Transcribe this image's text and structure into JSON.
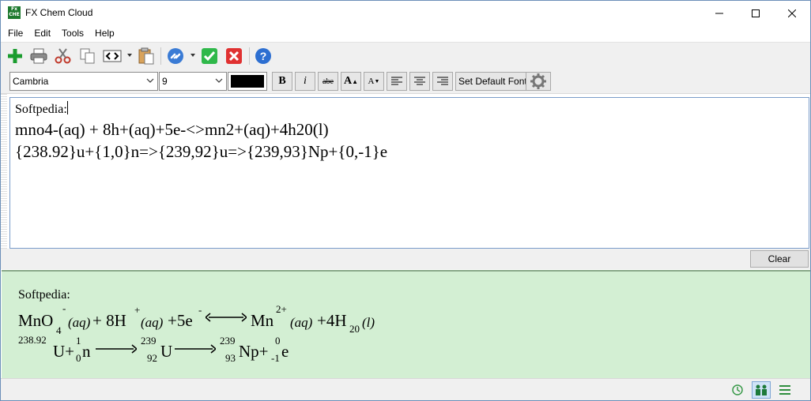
{
  "window": {
    "title": "FX Chem Cloud"
  },
  "menu": {
    "items": [
      "File",
      "Edit",
      "Tools",
      "Help"
    ]
  },
  "toolbar": {
    "icons": [
      "add-icon",
      "print-icon",
      "cut-icon",
      "copy-icon",
      "code-tag-icon",
      "paste-icon",
      "link-icon",
      "check-icon",
      "cancel-icon",
      "help-icon"
    ]
  },
  "format": {
    "font_name": "Cambria",
    "font_size": "9",
    "color": "#000000",
    "bold_label": "B",
    "italic_label": "i",
    "strike_label": "abe",
    "grow_label": "A",
    "shrink_label": "A",
    "default_font_label": "Set Default Font"
  },
  "editor": {
    "lines": [
      "Softpedia:",
      "mno4-(aq) + 8h+(aq)+5e-<>mn2+(aq)+4h20(l)",
      "{238.92}u+{1,0}n=>{239,92}u=>{239,93}Np+{0,-1}e"
    ]
  },
  "clear_label": "Clear",
  "preview": {
    "heading": "Softpedia:",
    "eq1": {
      "mno": "MnO",
      "sub4": "4",
      "sup_minus": "-",
      "aq1": "(aq)",
      "plus8h": " + 8H",
      "sup_plus": "+",
      "aq2": "(aq)",
      "plus5e": "+5e",
      "sup_minus2": "-",
      "mn": "Mn",
      "sup2plus": "2+",
      "aq3": "(aq)",
      "plus4h": "+4H",
      "sub20": "20",
      "liq": "(l)"
    },
    "eq2": {
      "sup23892": "238.92",
      "u1": "U+",
      "sup1": "1",
      "sub0": "0",
      "n": "n",
      "sup239a": "239",
      "sub92": "92",
      "u2": "U",
      "sup239b": "239",
      "sub93": "93",
      "np": "Np+",
      "sup0": "0",
      "subm1": "-1",
      "e": "e"
    }
  },
  "colors": {
    "preview_bg": "#d3efd3",
    "accent_green": "#1a9c2e",
    "cancel_red": "#e03131",
    "help_blue": "#2d6fd1"
  }
}
